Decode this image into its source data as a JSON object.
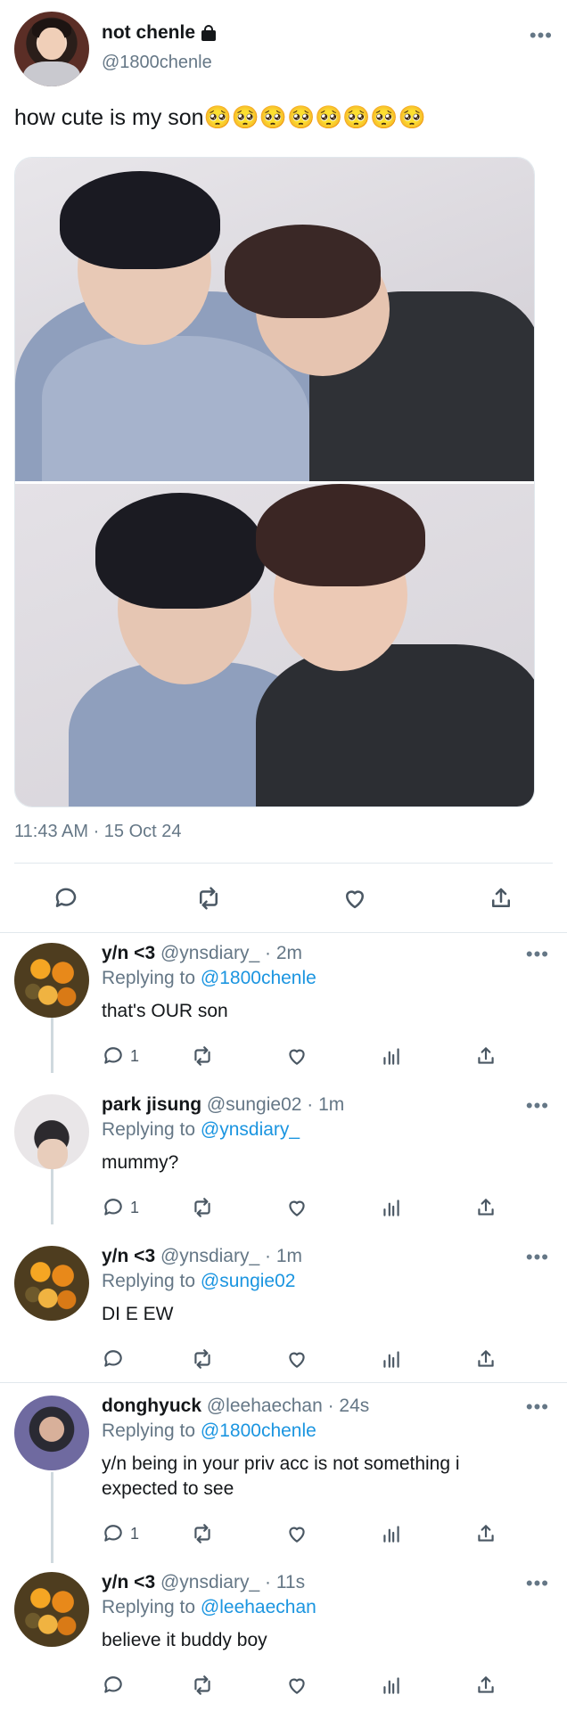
{
  "tweet": {
    "name": "not chenle",
    "handle": "@1800chenle",
    "text": "how cute is my son🥺🥺🥺🥺🥺🥺🥺🥺",
    "timestamp": "11:43 AM · 15 Oct 24",
    "icons": [
      "lock-icon",
      "more-icon",
      "reply-icon",
      "retweet-icon",
      "like-icon",
      "share-icon"
    ]
  },
  "replies": [
    {
      "name": "y/n <3",
      "meta": " @ynsdiary_ · 2m",
      "replying_prefix": "Replying to ",
      "replying_to": "@1800chenle",
      "text": "that's OUR son",
      "reply_count": "1"
    },
    {
      "name": "park jisung",
      "meta": " @sungie02 · 1m",
      "replying_prefix": "Replying to ",
      "replying_to": "@ynsdiary_",
      "text": "mummy?",
      "reply_count": "1"
    },
    {
      "name": "y/n <3",
      "meta": " @ynsdiary_ · 1m",
      "replying_prefix": "Replying to ",
      "replying_to": "@sungie02",
      "text": "DI E EW",
      "reply_count": ""
    },
    {
      "name": "donghyuck",
      "meta": " @leehaechan · 24s",
      "replying_prefix": "Replying to ",
      "replying_to": "@1800chenle",
      "text": "y/n being in your priv acc is not something i expected to see",
      "reply_count": "1"
    },
    {
      "name": "y/n <3",
      "meta": " @ynsdiary_ · 11s",
      "replying_prefix": "Replying to ",
      "replying_to": "@leehaechan",
      "text": "believe it buddy boy",
      "reply_count": ""
    }
  ],
  "colors": {
    "text": "#14171a",
    "secondary": "#657786",
    "link": "#1b95e0",
    "divider": "#e1e8ed"
  }
}
